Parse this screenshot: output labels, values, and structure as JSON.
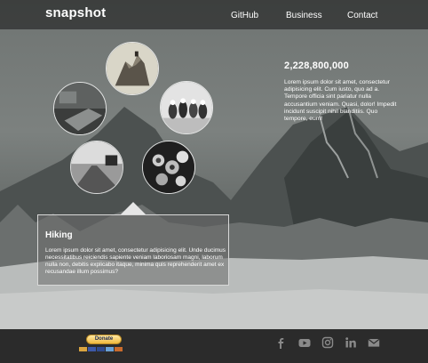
{
  "header": {
    "logo": "snapshot",
    "nav": [
      "GitHub",
      "Business",
      "Contact"
    ]
  },
  "gallery": {
    "circles": [
      "mountain-climber-photo",
      "laptop-photo",
      "dogs-photo",
      "road-photo",
      "camera-lens-photo"
    ]
  },
  "stat": {
    "number": "2,228,800,000",
    "text": "Lorem ipsum dolor sit amet, consectetur adipisicing elit. Cum iusto, quo ad a. Tempore officia sint pariatur nulla accusantium veniam. Quasi, dolor! Impedit incidunt suscipit nihil blanditiis. Quo tempore, eum!"
  },
  "card": {
    "title": "Hiking",
    "text": "Lorem ipsum dolor sit amet, consectetur adipisicing elit. Unde ducimus necessitatibus reiciendis sapiente veniam laboriosam magni, laborum nulla non, debitis explicabo itaque, minima quis reprehenderit amet ex recusandae illum possimus?"
  },
  "footer": {
    "donate_label": "Donate",
    "payment_cards": [
      "mastercard",
      "visa",
      "visa",
      "amex",
      "discover"
    ],
    "social": [
      "facebook-icon",
      "youtube-icon",
      "instagram-icon",
      "linkedin-icon",
      "mail-icon"
    ]
  },
  "colors": {
    "topbar": "#1e1e1e",
    "footer": "#2b2b2b",
    "donate": "#f0b83d",
    "icon": "#8a8a8a"
  }
}
